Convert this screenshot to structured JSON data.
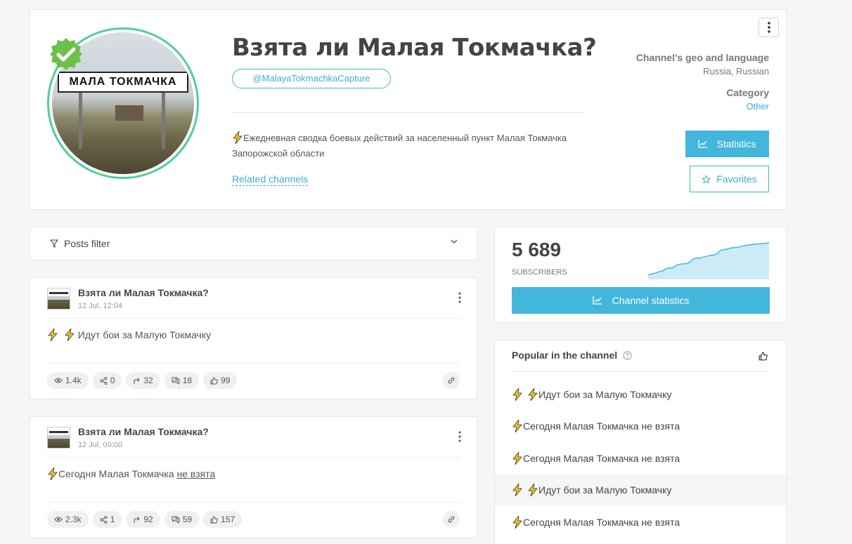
{
  "channel": {
    "title": "Взята ли Малая Токмачка?",
    "handle": "@MalayaTokmachkaCapture",
    "description": "Ежедневная сводка боевых действий за населенный пункт Малая Токмачка Запорожской области",
    "avatar_sign_text": "МАЛА ТОКМАЧКА",
    "related_label": "Related channels",
    "geo_label": "Channel's geo and language",
    "geo_value": "Russia, Russian",
    "category_label": "Category",
    "category_value": "Other",
    "statistics_button": "Statistics",
    "favorites_button": "Favorites"
  },
  "filter": {
    "label": "Posts filter"
  },
  "posts": [
    {
      "author": "Взята ли Малая Токмачка?",
      "date": "12 Jul, 12:04",
      "text": " Идут бои за Малую Токмачку",
      "views": "1.4k",
      "shares": "0",
      "forwards": "32",
      "comments": "18",
      "likes": "99"
    },
    {
      "author": "Взята ли Малая Токмачка?",
      "date": "12 Jul, 00:00",
      "text_plain": "Сегодня Малая Токмачка ",
      "text_underlined": "не взята",
      "views": "2.3k",
      "shares": "1",
      "forwards": "92",
      "comments": "59",
      "likes": "157"
    }
  ],
  "subscribers": {
    "count": "5 689",
    "label": "SUBSCRIBERS",
    "button": "Channel statistics",
    "trend": [
      0.05,
      0.08,
      0.1,
      0.14,
      0.16,
      0.22,
      0.26,
      0.25,
      0.33,
      0.36,
      0.38,
      0.38,
      0.42,
      0.52,
      0.55,
      0.55,
      0.58,
      0.6,
      0.63,
      0.64,
      0.68,
      0.78,
      0.8,
      0.82,
      0.85,
      0.86,
      0.87,
      0.9,
      0.92,
      0.94,
      0.95,
      0.96,
      0.97,
      0.98,
      0.99,
      1.0
    ]
  },
  "popular": {
    "title": "Popular in the channel",
    "items": [
      " Идут бои за Малую Токмачку",
      "Сегодня Малая Токмачка не взята",
      "Сегодня Малая Токмачка не взята",
      " Идут бои за Малую Токмачку",
      "Сегодня Малая Токмачка не взята"
    ],
    "highlighted_index": 3
  },
  "colors": {
    "accent": "#43b6de",
    "verified": "#6cc04a",
    "ring": "#4fcf9c"
  }
}
